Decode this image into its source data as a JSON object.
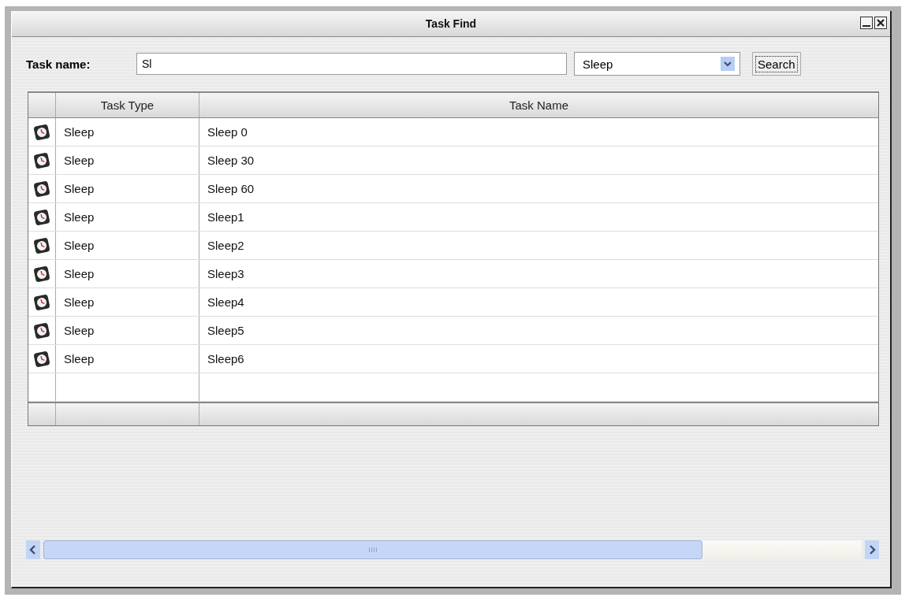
{
  "window": {
    "title": "Task Find"
  },
  "search": {
    "label": "Task name:",
    "value": "Sl",
    "type_value": "Sleep",
    "button": "Search"
  },
  "table": {
    "columns": [
      "Task Type",
      "Task Name"
    ],
    "rows": [
      {
        "type": "Sleep",
        "name": "Sleep 0"
      },
      {
        "type": "Sleep",
        "name": "Sleep 30"
      },
      {
        "type": "Sleep",
        "name": "Sleep 60"
      },
      {
        "type": "Sleep",
        "name": "Sleep1"
      },
      {
        "type": "Sleep",
        "name": "Sleep2"
      },
      {
        "type": "Sleep",
        "name": "Sleep3"
      },
      {
        "type": "Sleep",
        "name": "Sleep4"
      },
      {
        "type": "Sleep",
        "name": "Sleep5"
      },
      {
        "type": "Sleep",
        "name": "Sleep6"
      }
    ]
  }
}
